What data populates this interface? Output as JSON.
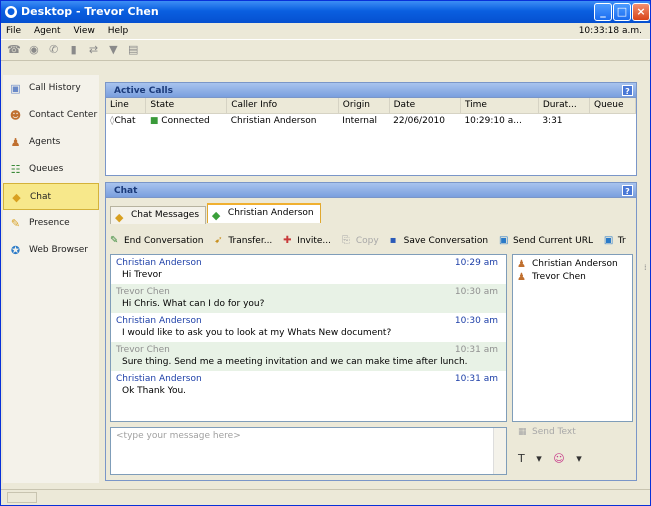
{
  "window": {
    "title": "Desktop - Trevor Chen",
    "app_icon": "app-icon"
  },
  "menu": {
    "items": [
      "File",
      "Agent",
      "View",
      "Help"
    ],
    "clock": "10:33:18 a.m."
  },
  "sidebar": {
    "items": [
      {
        "label": "Call History",
        "icon": "call-history-icon"
      },
      {
        "label": "Contact Center",
        "icon": "contact-center-icon"
      },
      {
        "label": "Agents",
        "icon": "agents-icon"
      },
      {
        "label": "Queues",
        "icon": "queues-icon"
      },
      {
        "label": "Chat",
        "icon": "chat-icon",
        "selected": true
      },
      {
        "label": "Presence",
        "icon": "presence-icon"
      },
      {
        "label": "Web Browser",
        "icon": "web-browser-icon"
      }
    ]
  },
  "active_calls": {
    "title": "Active Calls",
    "columns": [
      "Line",
      "State",
      "Caller Info",
      "Origin",
      "Date",
      "Time",
      "Durat...",
      "Queue"
    ],
    "rows": [
      {
        "line": "Chat",
        "state": "Connected",
        "caller": "Christian Anderson",
        "origin": "Internal",
        "date": "22/06/2010",
        "time": "10:29:10 a...",
        "duration": "3:31",
        "queue": ""
      }
    ]
  },
  "chat": {
    "title": "Chat",
    "tabs": [
      "Chat Messages",
      "Christian Anderson"
    ],
    "actions": [
      "End Conversation",
      "Transfer...",
      "Invite...",
      "Copy",
      "Save Conversation",
      "Send Current URL",
      "Tr"
    ],
    "messages": [
      {
        "sender": "Christian Anderson",
        "time": "10:29 am",
        "text": "Hi Trevor"
      },
      {
        "sender": "Trevor Chen",
        "time": "10:30 am",
        "text": "Hi Chris. What can I do for you?"
      },
      {
        "sender": "Christian Anderson",
        "time": "10:30 am",
        "text": "I would like to ask you to look at my Whats New document?"
      },
      {
        "sender": "Trevor Chen",
        "time": "10:31 am",
        "text": "Sure thing. Send me a meeting invitation and we can make time after lunch."
      },
      {
        "sender": "Christian Anderson",
        "time": "10:31 am",
        "text": "Ok Thank You."
      }
    ],
    "participants": [
      "Christian Anderson",
      "Trevor Chen"
    ],
    "compose_placeholder": "<type your message here>",
    "send_label": "Send Text"
  },
  "colors": {
    "title_bar": "#0a5fe0",
    "panel_header": "#a8c3ee",
    "selected_nav": "#f7e88b",
    "sender_blue": "#1d3fa8"
  }
}
